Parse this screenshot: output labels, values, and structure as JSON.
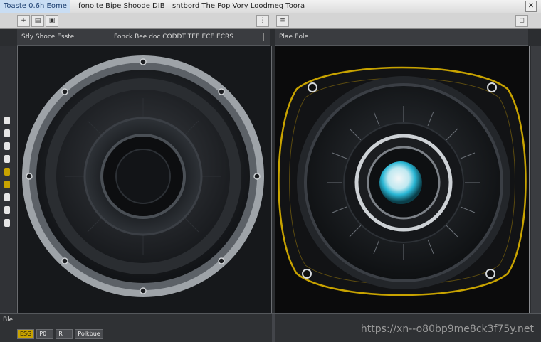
{
  "titlebar": {
    "app_label": "Toaste 0.6h Eome",
    "center_text": "fonoite Bipe Shoode DIB",
    "doc_title": "sntbord The  Pop Vory Loodmeg Toora",
    "close_glyph": "✕"
  },
  "left_panel": {
    "header_label": "Stly Shoce Esste",
    "header_sub": "Fonck Bee doc CODDT TEE ECE ECRS"
  },
  "right_panel": {
    "header_label": "Plae Eole"
  },
  "toolbar": {
    "icons": [
      "new-icon",
      "open-icon",
      "save-icon",
      "cut-icon",
      "copy-icon",
      "paste-icon",
      "undo-icon",
      "redo-icon",
      "zoom-icon",
      "grid-icon",
      "layers-icon",
      "brush-icon",
      "select-icon",
      "move-icon"
    ]
  },
  "status": {
    "line1": "Ble",
    "chips": [
      "ESG",
      "P0",
      "R",
      "Polkbue"
    ],
    "url": "https://xn--o80bp9me8ck3f75y.net"
  },
  "colors": {
    "accent_yellow": "#c8a300",
    "speaker_ring": "#9ea3a8",
    "tweeter_cyan": "#29b6d4"
  }
}
